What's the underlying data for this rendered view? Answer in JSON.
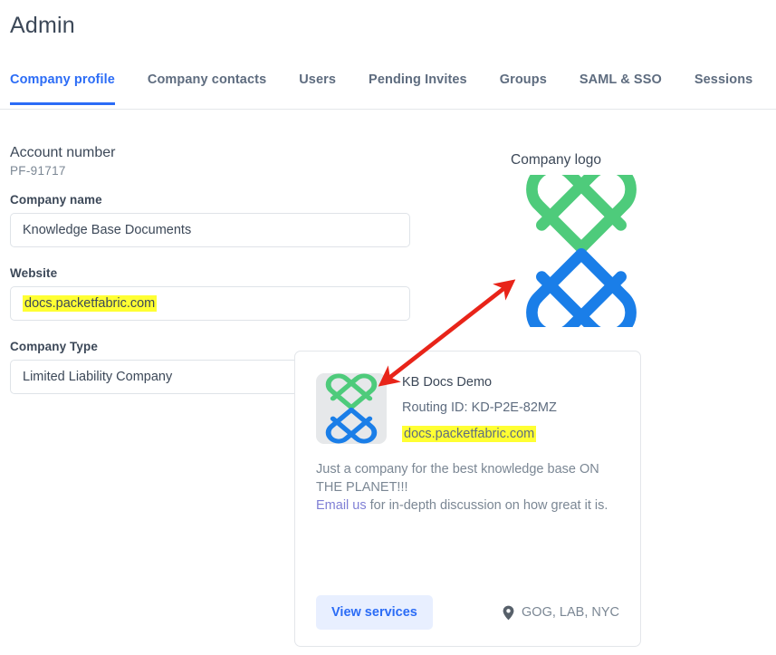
{
  "header": {
    "title": "Admin"
  },
  "tabs": [
    {
      "label": "Company profile",
      "active": true
    },
    {
      "label": "Company contacts",
      "active": false
    },
    {
      "label": "Users",
      "active": false
    },
    {
      "label": "Pending Invites",
      "active": false
    },
    {
      "label": "Groups",
      "active": false
    },
    {
      "label": "SAML & SSO",
      "active": false
    },
    {
      "label": "Sessions",
      "active": false
    }
  ],
  "form": {
    "account_number_label": "Account number",
    "account_number_value": "PF-91717",
    "company_name_label": "Company name",
    "company_name_value": "Knowledge Base Documents",
    "website_label": "Website",
    "website_value": "docs.packetfabric.com",
    "company_type_label": "Company Type",
    "company_type_value": "Limited Liability Company"
  },
  "logo": {
    "caption": "Company logo",
    "green": "#4ecb7b",
    "blue": "#1a7ee8",
    "thumb_bg": "#e6e8ea"
  },
  "card": {
    "name": "KB Docs Demo",
    "routing_id": "Routing ID: KD-P2E-82MZ",
    "website": "docs.packetfabric.com",
    "description_line1": "Just a company for the best knowledge base ON",
    "description_line2": "THE PLANET!!!",
    "email_link": "Email us",
    "description_line3": " for in-depth discussion on how great it is.",
    "view_services_label": "View services",
    "location": "GOG, LAB, NYC"
  },
  "colors": {
    "accent": "#2b6cf6",
    "highlight": "#ffff33",
    "annotation": "#e82419",
    "text": "#3c4858",
    "muted": "#7b8794"
  }
}
